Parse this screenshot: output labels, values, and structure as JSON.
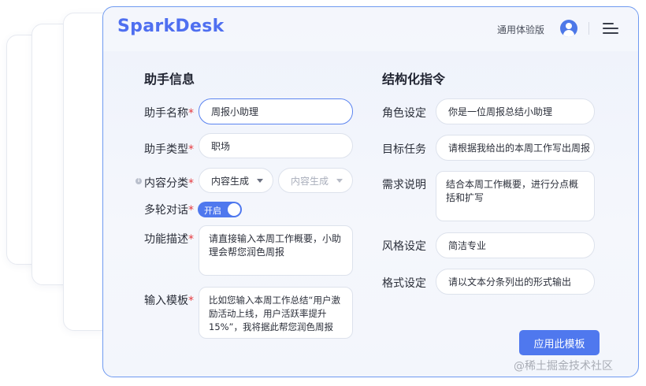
{
  "header": {
    "logo": "SparkDesk",
    "experience_link": "通用体验版"
  },
  "left_section": {
    "title": "助手信息",
    "name": {
      "label": "助手名称",
      "required": "*",
      "value": "周报小助理"
    },
    "type": {
      "label": "助手类型",
      "required": "*",
      "value": "职场"
    },
    "category": {
      "label": "内容分类",
      "required": "*",
      "select1": "内容生成",
      "select2": "内容生成"
    },
    "multi_turn": {
      "label": "多轮对话",
      "required": "*",
      "toggle_label": "开启",
      "enabled": true
    },
    "description": {
      "label": "功能描述",
      "required": "*",
      "value": "请直接输入本周工作概要，小助理会帮您润色周报"
    },
    "template": {
      "label": "输入模板",
      "required": "*",
      "value": "比如您输入本周工作总结“用户激励活动上线，用户活跃率提升15%”，我将据此帮您润色周报"
    }
  },
  "right_section": {
    "title": "结构化指令",
    "role": {
      "label": "角色设定",
      "value": "你是一位周报总结小助理"
    },
    "goal": {
      "label": "目标任务",
      "value": "请根据我给出的本周工作写出周报"
    },
    "requirement": {
      "label": "需求说明",
      "value": "结合本周工作概要，进行分点概括和扩写"
    },
    "style": {
      "label": "风格设定",
      "value": "简洁专业"
    },
    "format": {
      "label": "格式设定",
      "value": "请以文本分条列出的形式输出"
    }
  },
  "apply_button": "应用此模板",
  "watermark": "@稀土掘金技术社区",
  "colors": {
    "accent": "#4f78ee",
    "logo": "#4f6ff0",
    "required": "#e5393e",
    "border_focus": "#5b84f0"
  }
}
